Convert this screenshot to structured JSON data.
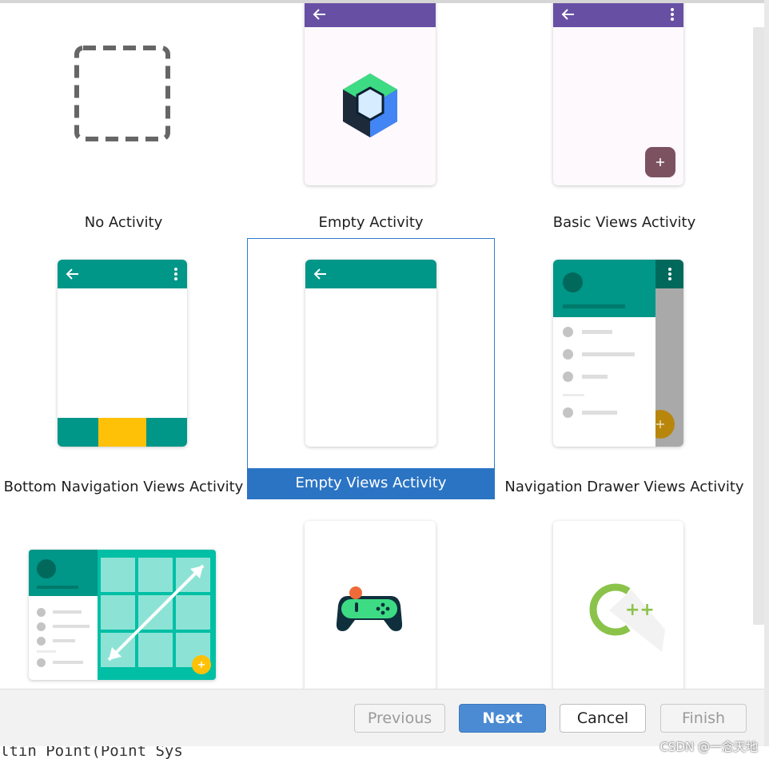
{
  "templates": [
    {
      "label": "No Activity"
    },
    {
      "label": "Empty Activity"
    },
    {
      "label": "Basic Views Activity"
    },
    {
      "label": "Bottom Navigation Views Activity"
    },
    {
      "label": "Empty Views Activity",
      "selected": true
    },
    {
      "label": "Navigation Drawer Views Activity"
    }
  ],
  "footer": {
    "previous_label": "Previous",
    "next_label": "Next",
    "cancel_label": "Cancel",
    "finish_label": "Finish"
  },
  "background_code": "ltin Point(Point Sys",
  "watermark": "CSDN @一念天地",
  "colors": {
    "purple_appbar": "#6750a4",
    "teal_appbar": "#009688",
    "selection_blue": "#2b74c4",
    "fab_purple": "#7d5260",
    "nav_yellow": "#ffc107",
    "primary_button": "#4a8bd3"
  },
  "icons": [
    "dashed-square-icon",
    "compose-logo-icon",
    "gamepad-icon",
    "cpp-logo-icon",
    "arrow-back-icon",
    "more-vert-icon",
    "plus-icon"
  ]
}
